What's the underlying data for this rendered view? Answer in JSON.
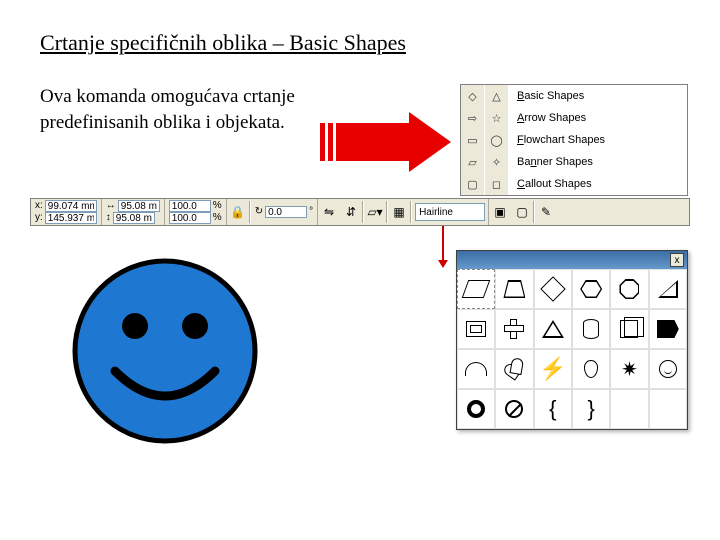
{
  "title": "Crtanje specifičnih oblika – Basic Shapes",
  "intro": "Ova komanda omogućava crtanje predefinisanih oblika i objekata.",
  "menu": {
    "items": [
      {
        "label": "Basic Shapes",
        "u": "B"
      },
      {
        "label": "Arrow Shapes",
        "u": "A"
      },
      {
        "label": "Flowchart Shapes",
        "u": "F"
      },
      {
        "label": "Banner Shapes",
        "u": "n"
      },
      {
        "label": "Callout Shapes",
        "u": "C"
      }
    ]
  },
  "propbar": {
    "x": "99.074 mm",
    "y": "145.937 mm",
    "w": "95.08 mm",
    "h": "95.08 mm",
    "sx": "100.0",
    "sy": "100.0",
    "angle": "0.0",
    "outline": "Hairline"
  },
  "palette": {
    "close": "x",
    "shapes": [
      "parallelogram",
      "trapezoid",
      "diamond",
      "hexagon",
      "octagon",
      "triangle",
      "frame",
      "cross",
      "right-triangle",
      "cylinder",
      "cube",
      "arrow-pent",
      "arc",
      "heart",
      "bolt",
      "drop",
      "explosion",
      "smile",
      "ring",
      "no-entry",
      "brace-l",
      "brace-r",
      "",
      ""
    ]
  }
}
